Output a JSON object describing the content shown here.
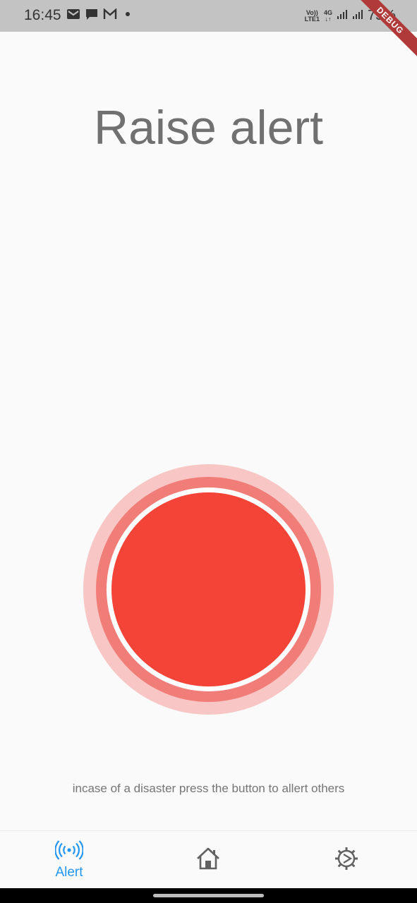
{
  "status_bar": {
    "time": "16:45",
    "network_top": "Vo))",
    "network_bottom": "LTE1",
    "network_4g": "4G",
    "battery": "75%"
  },
  "debug_banner": "DEBUG",
  "page": {
    "title": "Raise alert",
    "hint": "incase of a disaster press the button to allert others"
  },
  "colors": {
    "accent": "#2196f3",
    "alert_core": "#f44337",
    "alert_ring_mid": "#f17d79",
    "alert_ring_outer": "#f8c6c4"
  },
  "bottom_nav": {
    "items": [
      {
        "label": "Alert",
        "icon": "broadcast-icon",
        "active": true
      },
      {
        "label": "",
        "icon": "home-icon",
        "active": false
      },
      {
        "label": "",
        "icon": "settings-icon",
        "active": false
      }
    ]
  }
}
